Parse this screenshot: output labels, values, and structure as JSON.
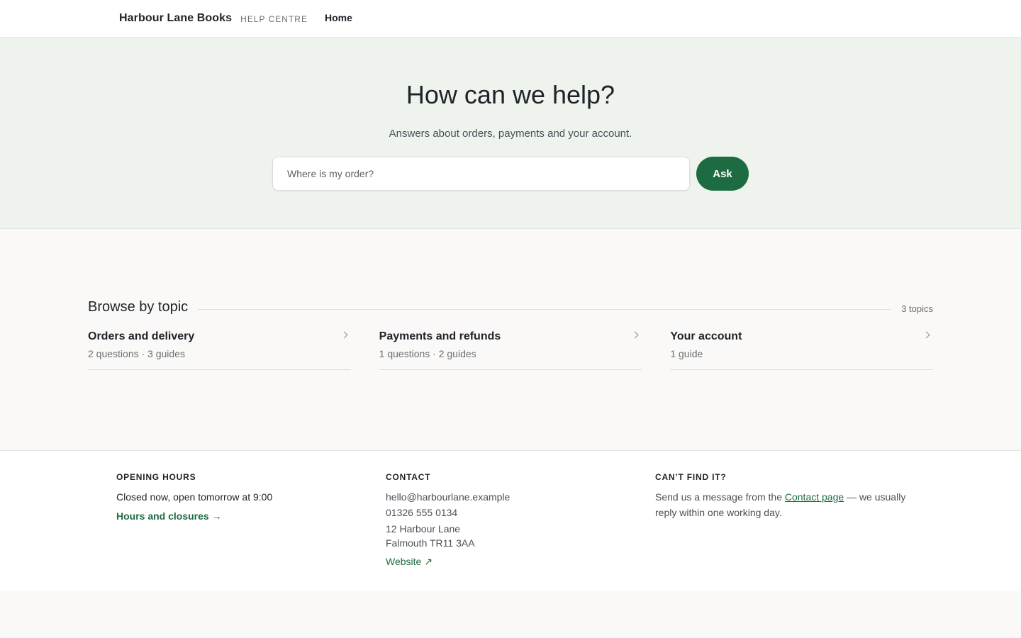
{
  "header": {
    "brand": "Harbour Lane Books",
    "brand_sub": "HELP CENTRE",
    "nav_home": "Home"
  },
  "hero": {
    "title": "How can we help?",
    "subtitle": "Answers about orders, payments and your account.",
    "search_placeholder": "Where is my order?",
    "search_value": "",
    "ask_label": "Ask"
  },
  "topics": {
    "title": "Browse by topic",
    "count": "3 topics",
    "items": [
      {
        "name": "Orders and delivery",
        "meta": "2 questions · 3 guides",
        "icon": "chevron-right-icon"
      },
      {
        "name": "Payments and refunds",
        "meta": "1 questions · 2 guides",
        "icon": "chevron-right-icon"
      },
      {
        "name": "Your account",
        "meta": "1 guide",
        "icon": "chevron-right-icon"
      }
    ]
  },
  "footer": {
    "hours": {
      "heading": "OPENING HOURS",
      "status": "Closed now, open tomorrow at 9:00",
      "link": "Hours and closures →"
    },
    "contact": {
      "heading": "CONTACT",
      "email": "hello@harbourlane.example",
      "phone": "01326 555 0134",
      "address_line1": "12 Harbour Lane",
      "address_line2": "Falmouth TR11 3AA",
      "website": "Website ↗"
    },
    "cant_find": {
      "heading": "CAN’T FIND IT?",
      "text_before": "Send us a message from the ",
      "link": "Contact page",
      "text_after": " — we usually reply within one working day."
    }
  },
  "colors": {
    "accent": "#1d6b41",
    "hero_bg": "#eef3ee",
    "page_bg": "#faf9f7"
  }
}
